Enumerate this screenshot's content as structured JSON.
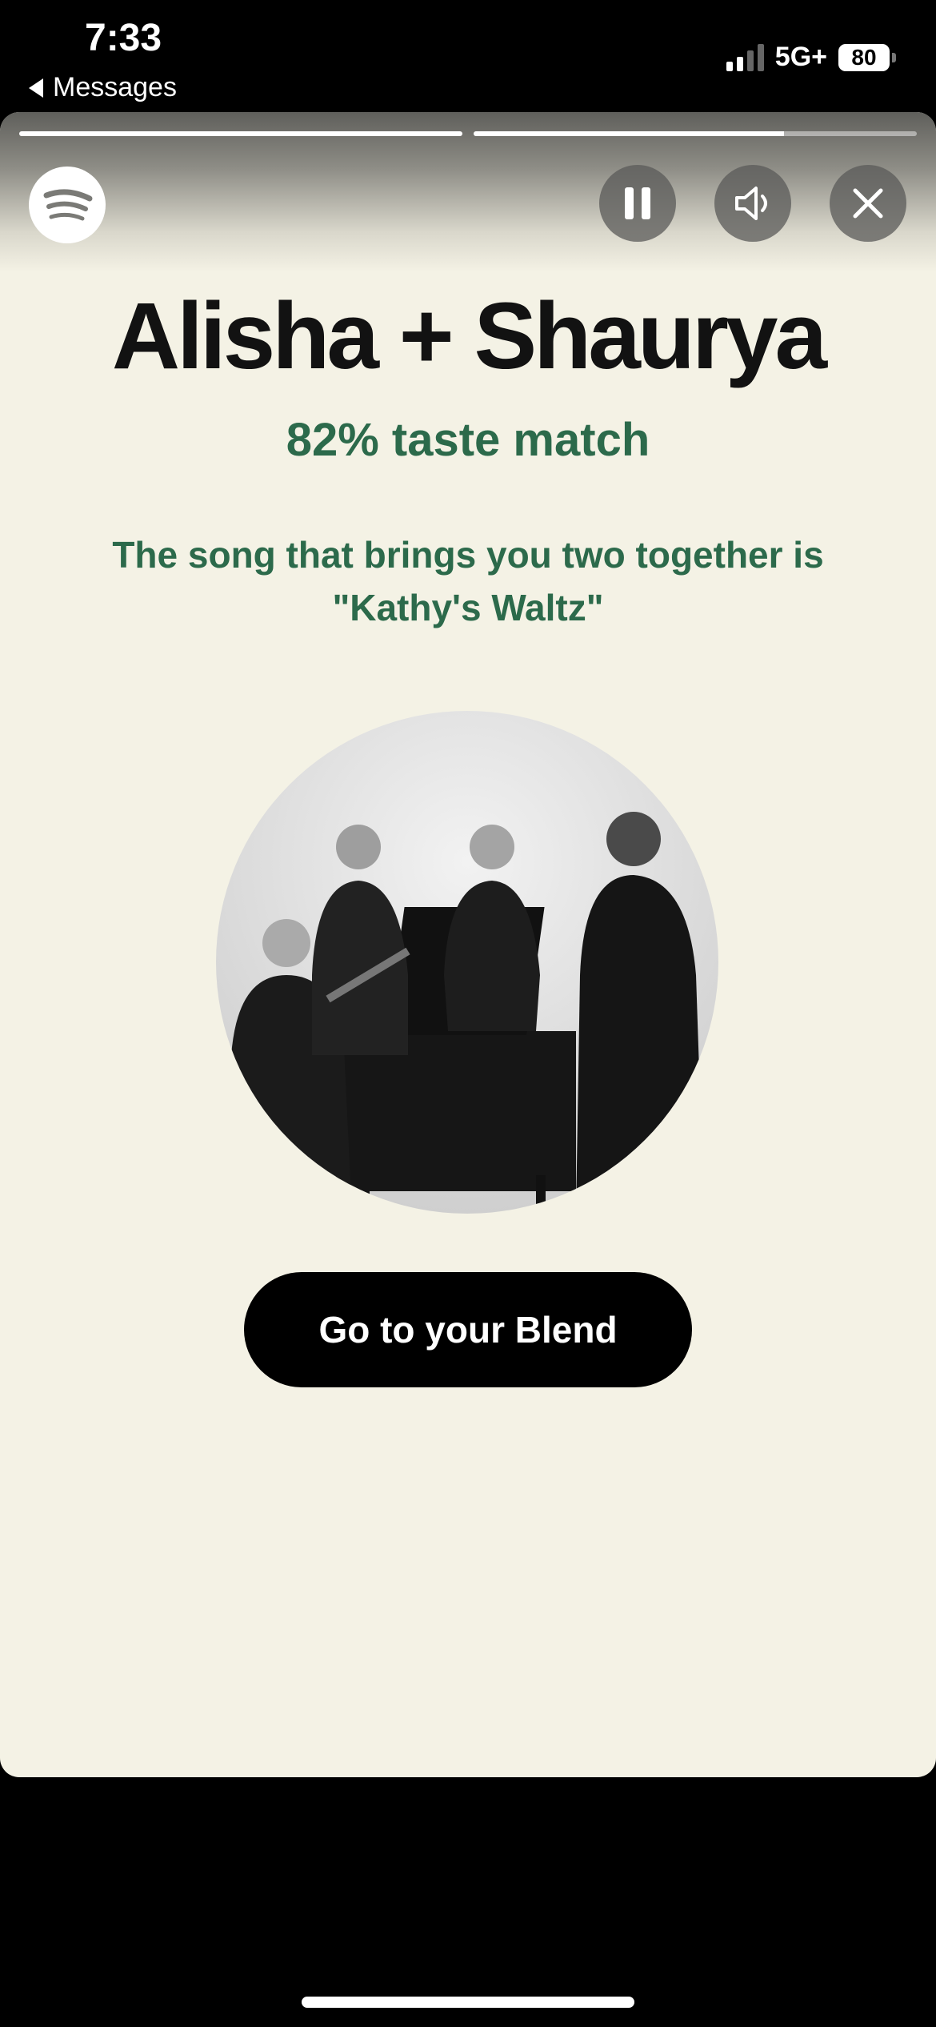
{
  "status_bar": {
    "time": "7:33",
    "back_label": "Messages",
    "network": "5G+",
    "battery": "80"
  },
  "story": {
    "progress": [
      1.0,
      0.7
    ],
    "controls": {
      "pause_icon": "pause-icon",
      "sound_icon": "speaker-icon",
      "close_icon": "close-icon"
    }
  },
  "content": {
    "title": "Alisha + Shaurya",
    "match": "82% taste match",
    "song_intro": "The song that brings you two together is",
    "song_name": "\"Kathy's Waltz\"",
    "button_label": "Go to your Blend"
  },
  "colors": {
    "background": "#f4f2e5",
    "accent_green": "#2c6a4b",
    "button": "#000000"
  }
}
